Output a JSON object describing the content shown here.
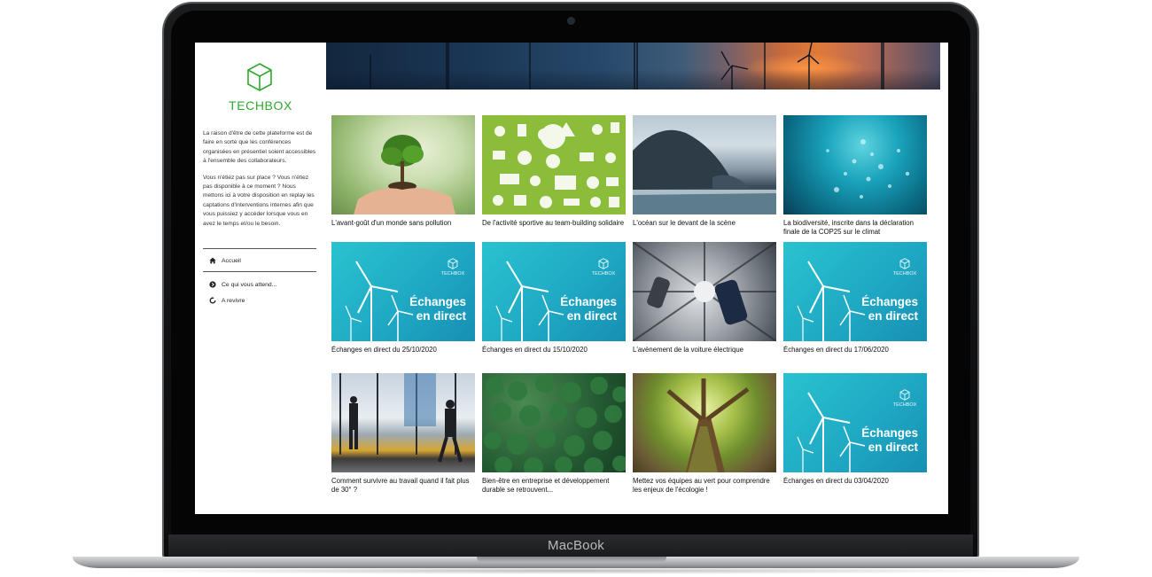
{
  "device": {
    "brand_label": "MacBook"
  },
  "sidebar": {
    "logo_text": "TECHBOX",
    "intro_paragraphs": [
      "La raison d'être de cette plateforme est de faire en sorte que les conférences organisées en présentiel soient accessibles à l'ensemble des collaborateurs.",
      "Vous n'étiez pas sur place ? Vous n'étiez pas disponible à ce moment ? Nous mettons ici à votre disposition en replay les captations d'interventions internes afin que vous puissiez y accéder lorsque vous en avez le temps et/ou le besoin."
    ],
    "nav": [
      {
        "label": "Accueil",
        "icon": "home-icon"
      },
      {
        "label": "Ce qui vous attend...",
        "icon": "circle-arrow-icon"
      },
      {
        "label": "A revivre",
        "icon": "replay-icon"
      }
    ]
  },
  "live_overlay": {
    "line1": "Échanges",
    "line2": "en direct",
    "brand": "TECHBOX"
  },
  "cards": [
    {
      "title": "L'avant-goût d'un monde sans pollution",
      "thumb": "tree"
    },
    {
      "title": "De l'activité sportive au team-building solidaire",
      "thumb": "eco"
    },
    {
      "title": "L'océan sur le devant de la scène",
      "thumb": "ocean"
    },
    {
      "title": "La biodiversité, inscrite dans la déclaration finale de la COP25 sur le climat",
      "thumb": "water"
    },
    {
      "title": "Échanges en direct du 25/10/2020",
      "thumb": "live"
    },
    {
      "title": "Échanges en direct du 15/10/2020",
      "thumb": "live"
    },
    {
      "title": "L'avènement de la voiture électrique",
      "thumb": "car"
    },
    {
      "title": "Échanges en direct du 17/06/2020",
      "thumb": "live"
    },
    {
      "title": "Comment survivre au travail quand il fait plus de 30° ?",
      "thumb": "office"
    },
    {
      "title": "Bien-être en entreprise et développement durable se retrouvent...",
      "thumb": "forest"
    },
    {
      "title": "Mettez vos équipes au vert pour comprendre les enjeux de l'écologie !",
      "thumb": "trunk"
    },
    {
      "title": "Échanges en direct du 03/04/2020",
      "thumb": "live"
    }
  ],
  "colors": {
    "brand_green": "#2fa82f",
    "live_teal": "#1fa9c4"
  }
}
